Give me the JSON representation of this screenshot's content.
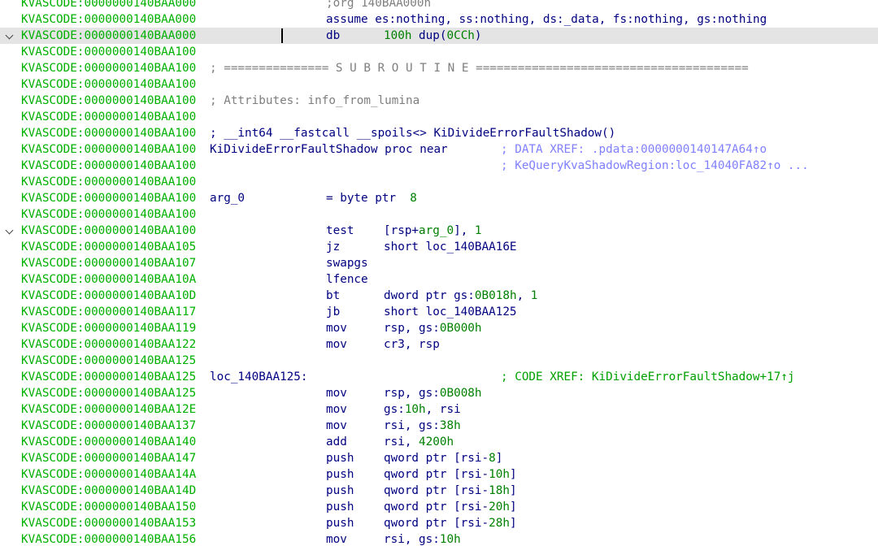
{
  "listing": {
    "lines": [
      {
        "addr": "KVASCODE:0000000140BAA000",
        "kind": "directive-gray",
        "text": ";org 140BAA000h"
      },
      {
        "addr": "KVASCODE:0000000140BAA000",
        "kind": "directive",
        "text": "assume es:nothing, ss:nothing, ds:_data, fs:nothing, gs:nothing"
      },
      {
        "addr": "KVASCODE:0000000140BAA000",
        "kind": "db",
        "gutter": "chevron",
        "current": true,
        "mnem": "db",
        "ops_pre": "",
        "ops_num": "100h",
        "ops_mid": " dup(",
        "ops_num2": "0CCh",
        "ops_post": ")"
      },
      {
        "addr": "KVASCODE:0000000140BAA100",
        "kind": "empty"
      },
      {
        "addr": "KVASCODE:0000000140BAA100",
        "kind": "comment-full",
        "text": "; =============== S U B R O U T I N E ======================================="
      },
      {
        "addr": "KVASCODE:0000000140BAA100",
        "kind": "empty"
      },
      {
        "addr": "KVASCODE:0000000140BAA100",
        "kind": "comment-full",
        "text": "; Attributes: info_from_lumina"
      },
      {
        "addr": "KVASCODE:0000000140BAA100",
        "kind": "empty"
      },
      {
        "addr": "KVASCODE:0000000140BAA100",
        "kind": "comment-blue",
        "text": "; __int64 __fastcall __spoils<> KiDivideErrorFaultShadow()"
      },
      {
        "addr": "KVASCODE:0000000140BAA100",
        "kind": "label",
        "text": "KiDivideErrorFaultShadow proc near",
        "xref": "; DATA XREF: .pdata:0000000140147A64↑o"
      },
      {
        "addr": "KVASCODE:0000000140BAA100",
        "kind": "xref-only",
        "xref": "; KeQueryKvaShadowRegion:loc_14040FA82↑o ..."
      },
      {
        "addr": "KVASCODE:0000000140BAA100",
        "kind": "empty"
      },
      {
        "addr": "KVASCODE:0000000140BAA100",
        "kind": "arg",
        "label": "arg_0",
        "text": "= byte ptr  ",
        "num": "8"
      },
      {
        "addr": "KVASCODE:0000000140BAA100",
        "kind": "empty"
      },
      {
        "addr": "KVASCODE:0000000140BAA100",
        "kind": "insn",
        "gutter": "chevron",
        "mnem": "test",
        "ops": "[rsp+",
        "var": "arg_0",
        "ops2": "], ",
        "num": "1"
      },
      {
        "addr": "KVASCODE:0000000140BAA105",
        "kind": "insn",
        "mnem": "jz",
        "ops": "short loc_140BAA16E"
      },
      {
        "addr": "KVASCODE:0000000140BAA107",
        "kind": "insn",
        "mnem": "swapgs",
        "ops": ""
      },
      {
        "addr": "KVASCODE:0000000140BAA10A",
        "kind": "insn",
        "mnem": "lfence",
        "ops": ""
      },
      {
        "addr": "KVASCODE:0000000140BAA10D",
        "kind": "insn",
        "mnem": "bt",
        "ops": "dword ptr gs:",
        "num": "0B018h",
        "ops2": ", ",
        "num2": "1"
      },
      {
        "addr": "KVASCODE:0000000140BAA117",
        "kind": "insn",
        "mnem": "jb",
        "ops": "short loc_140BAA125"
      },
      {
        "addr": "KVASCODE:0000000140BAA119",
        "kind": "insn",
        "mnem": "mov",
        "ops": "rsp, gs:",
        "num": "0B000h"
      },
      {
        "addr": "KVASCODE:0000000140BAA122",
        "kind": "insn",
        "mnem": "mov",
        "ops": "cr3, rsp"
      },
      {
        "addr": "KVASCODE:0000000140BAA125",
        "kind": "empty"
      },
      {
        "addr": "KVASCODE:0000000140BAA125",
        "kind": "label",
        "text": "loc_140BAA125:",
        "xref": "; CODE XREF: KiDivideErrorFaultShadow+17↑j",
        "xref_green": true
      },
      {
        "addr": "KVASCODE:0000000140BAA125",
        "kind": "insn",
        "mnem": "mov",
        "ops": "rsp, gs:",
        "num": "0B008h"
      },
      {
        "addr": "KVASCODE:0000000140BAA12E",
        "kind": "insn",
        "mnem": "mov",
        "ops": "gs:",
        "num": "10h",
        "ops2": ", rsi"
      },
      {
        "addr": "KVASCODE:0000000140BAA137",
        "kind": "insn",
        "mnem": "mov",
        "ops": "rsi, gs:",
        "num": "38h"
      },
      {
        "addr": "KVASCODE:0000000140BAA140",
        "kind": "insn",
        "mnem": "add",
        "ops": "rsi, ",
        "num": "4200h"
      },
      {
        "addr": "KVASCODE:0000000140BAA147",
        "kind": "insn",
        "mnem": "push",
        "ops": "qword ptr [rsi-",
        "num": "8",
        "ops2": "]"
      },
      {
        "addr": "KVASCODE:0000000140BAA14A",
        "kind": "insn",
        "mnem": "push",
        "ops": "qword ptr [rsi-",
        "num": "10h",
        "ops2": "]"
      },
      {
        "addr": "KVASCODE:0000000140BAA14D",
        "kind": "insn",
        "mnem": "push",
        "ops": "qword ptr [rsi-",
        "num": "18h",
        "ops2": "]"
      },
      {
        "addr": "KVASCODE:0000000140BAA150",
        "kind": "insn",
        "mnem": "push",
        "ops": "qword ptr [rsi-",
        "num": "20h",
        "ops2": "]"
      },
      {
        "addr": "KVASCODE:0000000140BAA153",
        "kind": "insn",
        "mnem": "push",
        "ops": "qword ptr [rsi-",
        "num": "28h",
        "ops2": "]"
      },
      {
        "addr": "KVASCODE:0000000140BAA156",
        "kind": "insn",
        "mnem": "mov",
        "ops": "rsi, gs:",
        "num": "10h"
      }
    ]
  },
  "colors": {
    "address": "#00b000",
    "instruction": "#000080",
    "number": "#008000",
    "comment": "#7f7f7f",
    "xref": "#8080ff",
    "current_line": "#e4e4e4"
  }
}
